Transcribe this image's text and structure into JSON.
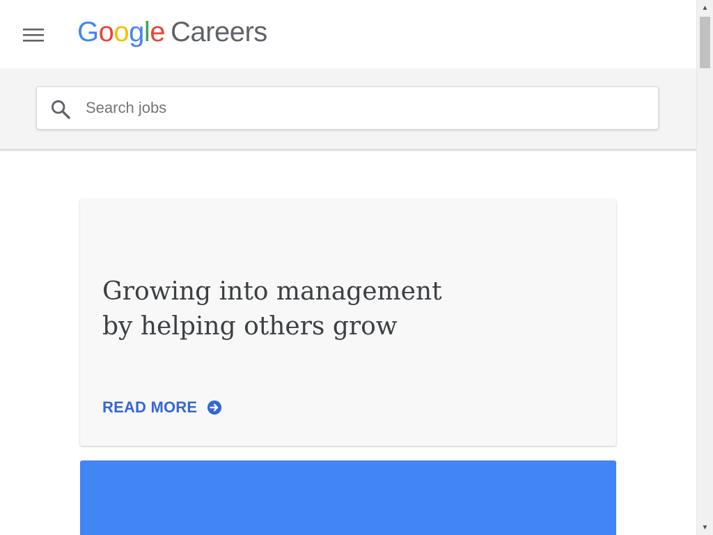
{
  "header": {
    "menu_icon": "hamburger-menu-icon",
    "logo": {
      "google_letters": [
        {
          "char": "G",
          "color": "#4285F4"
        },
        {
          "char": "o",
          "color": "#EA4335"
        },
        {
          "char": "o",
          "color": "#FBBC05"
        },
        {
          "char": "g",
          "color": "#4285F4"
        },
        {
          "char": "l",
          "color": "#34A853"
        },
        {
          "char": "e",
          "color": "#EA4335"
        }
      ],
      "careers_text": "Careers"
    }
  },
  "search": {
    "icon": "search-icon",
    "placeholder": "Search jobs",
    "value": ""
  },
  "story_card": {
    "title_line_1": "Growing into management",
    "title_line_2": "by helping others grow",
    "read_more_label": "READ MORE",
    "read_more_icon": "arrow-right-circle-icon"
  },
  "colors": {
    "accent_link": "#3367D6",
    "blue_card": "#4285F4",
    "search_band": "#F4F4F4",
    "card_bg": "#F8F8F8"
  },
  "scrollbar": {
    "up_arrow": "▲",
    "down_arrow": "▼"
  }
}
